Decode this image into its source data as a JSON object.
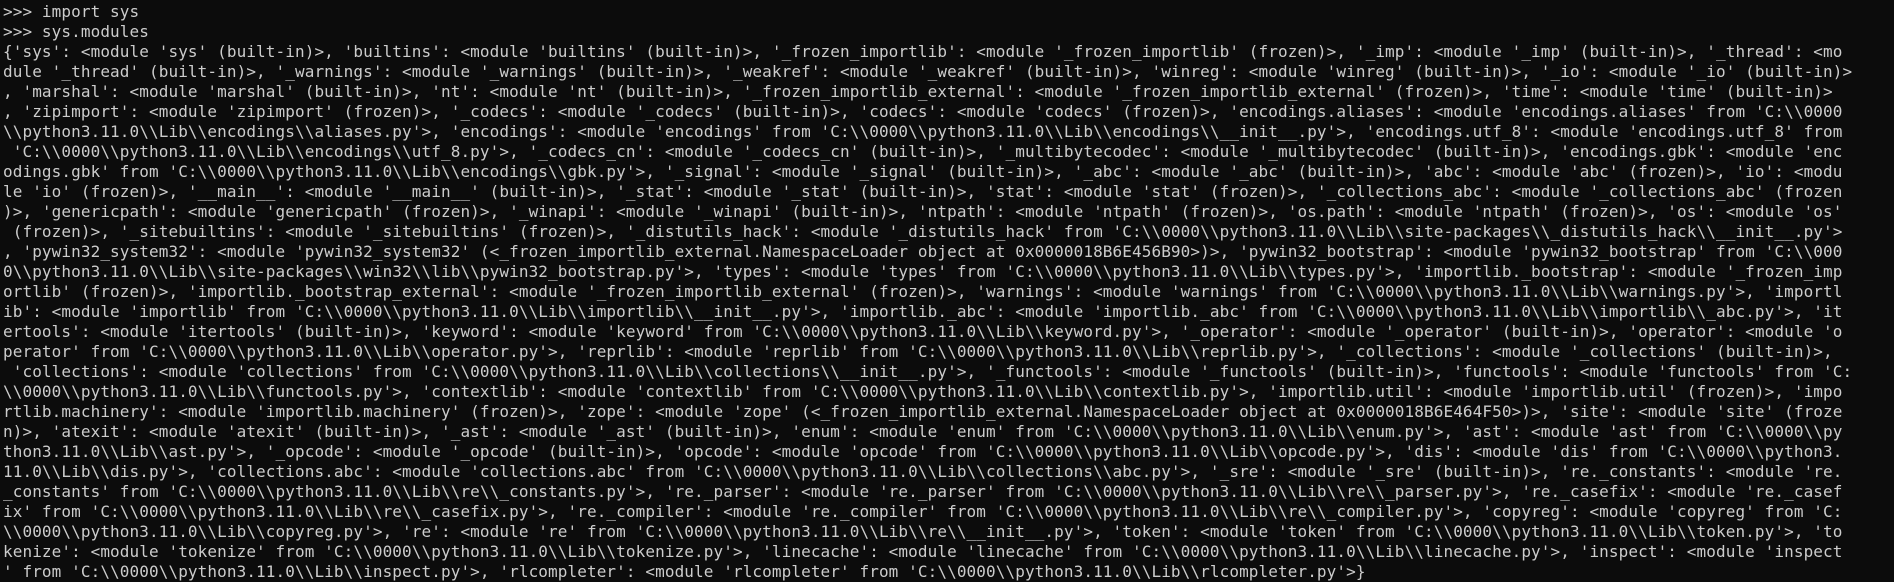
{
  "console": {
    "colors": {
      "background": "#0c0c0c",
      "foreground": "#cccccc"
    },
    "lines": [
      ">>> import sys",
      ">>> sys.modules",
      "{'sys': <module 'sys' (built-in)>, 'builtins': <module 'builtins' (built-in)>, '_frozen_importlib': <module '_frozen_importlib' (frozen)>, '_imp': <module '_imp' (built-in)>, '_thread': <mo",
      "dule '_thread' (built-in)>, '_warnings': <module '_warnings' (built-in)>, '_weakref': <module '_weakref' (built-in)>, 'winreg': <module 'winreg' (built-in)>, '_io': <module '_io' (built-in)>",
      ", 'marshal': <module 'marshal' (built-in)>, 'nt': <module 'nt' (built-in)>, '_frozen_importlib_external': <module '_frozen_importlib_external' (frozen)>, 'time': <module 'time' (built-in)>",
      ", 'zipimport': <module 'zipimport' (frozen)>, '_codecs': <module '_codecs' (built-in)>, 'codecs': <module 'codecs' (frozen)>, 'encodings.aliases': <module 'encodings.aliases' from 'C:\\\\0000",
      "\\\\python3.11.0\\\\Lib\\\\encodings\\\\aliases.py'>, 'encodings': <module 'encodings' from 'C:\\\\0000\\\\python3.11.0\\\\Lib\\\\encodings\\\\__init__.py'>, 'encodings.utf_8': <module 'encodings.utf_8' from",
      " 'C:\\\\0000\\\\python3.11.0\\\\Lib\\\\encodings\\\\utf_8.py'>, '_codecs_cn': <module '_codecs_cn' (built-in)>, '_multibytecodec': <module '_multibytecodec' (built-in)>, 'encodings.gbk': <module 'enc",
      "odings.gbk' from 'C:\\\\0000\\\\python3.11.0\\\\Lib\\\\encodings\\\\gbk.py'>, '_signal': <module '_signal' (built-in)>, '_abc': <module '_abc' (built-in)>, 'abc': <module 'abc' (frozen)>, 'io': <modu",
      "le 'io' (frozen)>, '__main__': <module '__main__' (built-in)>, '_stat': <module '_stat' (built-in)>, 'stat': <module 'stat' (frozen)>, '_collections_abc': <module '_collections_abc' (frozen",
      ")>, 'genericpath': <module 'genericpath' (frozen)>, '_winapi': <module '_winapi' (built-in)>, 'ntpath': <module 'ntpath' (frozen)>, 'os.path': <module 'ntpath' (frozen)>, 'os': <module 'os'",
      " (frozen)>, '_sitebuiltins': <module '_sitebuiltins' (frozen)>, '_distutils_hack': <module '_distutils_hack' from 'C:\\\\0000\\\\python3.11.0\\\\Lib\\\\site-packages\\\\_distutils_hack\\\\__init__.py'>",
      ", 'pywin32_system32': <module 'pywin32_system32' (<_frozen_importlib_external.NamespaceLoader object at 0x0000018B6E456B90>)>, 'pywin32_bootstrap': <module 'pywin32_bootstrap' from 'C:\\\\000",
      "0\\\\python3.11.0\\\\Lib\\\\site-packages\\\\win32\\\\lib\\\\pywin32_bootstrap.py'>, 'types': <module 'types' from 'C:\\\\0000\\\\python3.11.0\\\\Lib\\\\types.py'>, 'importlib._bootstrap': <module '_frozen_imp",
      "ortlib' (frozen)>, 'importlib._bootstrap_external': <module '_frozen_importlib_external' (frozen)>, 'warnings': <module 'warnings' from 'C:\\\\0000\\\\python3.11.0\\\\Lib\\\\warnings.py'>, 'importl",
      "ib': <module 'importlib' from 'C:\\\\0000\\\\python3.11.0\\\\Lib\\\\importlib\\\\__init__.py'>, 'importlib._abc': <module 'importlib._abc' from 'C:\\\\0000\\\\python3.11.0\\\\Lib\\\\importlib\\\\_abc.py'>, 'it",
      "ertools': <module 'itertools' (built-in)>, 'keyword': <module 'keyword' from 'C:\\\\0000\\\\python3.11.0\\\\Lib\\\\keyword.py'>, '_operator': <module '_operator' (built-in)>, 'operator': <module 'o",
      "perator' from 'C:\\\\0000\\\\python3.11.0\\\\Lib\\\\operator.py'>, 'reprlib': <module 'reprlib' from 'C:\\\\0000\\\\python3.11.0\\\\Lib\\\\reprlib.py'>, '_collections': <module '_collections' (built-in)>,",
      " 'collections': <module 'collections' from 'C:\\\\0000\\\\python3.11.0\\\\Lib\\\\collections\\\\__init__.py'>, '_functools': <module '_functools' (built-in)>, 'functools': <module 'functools' from 'C:",
      "\\\\0000\\\\python3.11.0\\\\Lib\\\\functools.py'>, 'contextlib': <module 'contextlib' from 'C:\\\\0000\\\\python3.11.0\\\\Lib\\\\contextlib.py'>, 'importlib.util': <module 'importlib.util' (frozen)>, 'impo",
      "rtlib.machinery': <module 'importlib.machinery' (frozen)>, 'zope': <module 'zope' (<_frozen_importlib_external.NamespaceLoader object at 0x0000018B6E464F50>)>, 'site': <module 'site' (froze",
      "n)>, 'atexit': <module 'atexit' (built-in)>, '_ast': <module '_ast' (built-in)>, 'enum': <module 'enum' from 'C:\\\\0000\\\\python3.11.0\\\\Lib\\\\enum.py'>, 'ast': <module 'ast' from 'C:\\\\0000\\\\py",
      "thon3.11.0\\\\Lib\\\\ast.py'>, '_opcode': <module '_opcode' (built-in)>, 'opcode': <module 'opcode' from 'C:\\\\0000\\\\python3.11.0\\\\Lib\\\\opcode.py'>, 'dis': <module 'dis' from 'C:\\\\0000\\\\python3.",
      "11.0\\\\Lib\\\\dis.py'>, 'collections.abc': <module 'collections.abc' from 'C:\\\\0000\\\\python3.11.0\\\\Lib\\\\collections\\\\abc.py'>, '_sre': <module '_sre' (built-in)>, 're._constants': <module 're.",
      "_constants' from 'C:\\\\0000\\\\python3.11.0\\\\Lib\\\\re\\\\_constants.py'>, 're._parser': <module 're._parser' from 'C:\\\\0000\\\\python3.11.0\\\\Lib\\\\re\\\\_parser.py'>, 're._casefix': <module 're._casef",
      "ix' from 'C:\\\\0000\\\\python3.11.0\\\\Lib\\\\re\\\\_casefix.py'>, 're._compiler': <module 're._compiler' from 'C:\\\\0000\\\\python3.11.0\\\\Lib\\\\re\\\\_compiler.py'>, 'copyreg': <module 'copyreg' from 'C:",
      "\\\\0000\\\\python3.11.0\\\\Lib\\\\copyreg.py'>, 're': <module 're' from 'C:\\\\0000\\\\python3.11.0\\\\Lib\\\\re\\\\__init__.py'>, 'token': <module 'token' from 'C:\\\\0000\\\\python3.11.0\\\\Lib\\\\token.py'>, 'to",
      "kenize': <module 'tokenize' from 'C:\\\\0000\\\\python3.11.0\\\\Lib\\\\tokenize.py'>, 'linecache': <module 'linecache' from 'C:\\\\0000\\\\python3.11.0\\\\Lib\\\\linecache.py'>, 'inspect': <module 'inspect",
      "' from 'C:\\\\0000\\\\python3.11.0\\\\Lib\\\\inspect.py'>, 'rlcompleter': <module 'rlcompleter' from 'C:\\\\0000\\\\python3.11.0\\\\Lib\\\\rlcompleter.py'>}"
    ]
  }
}
